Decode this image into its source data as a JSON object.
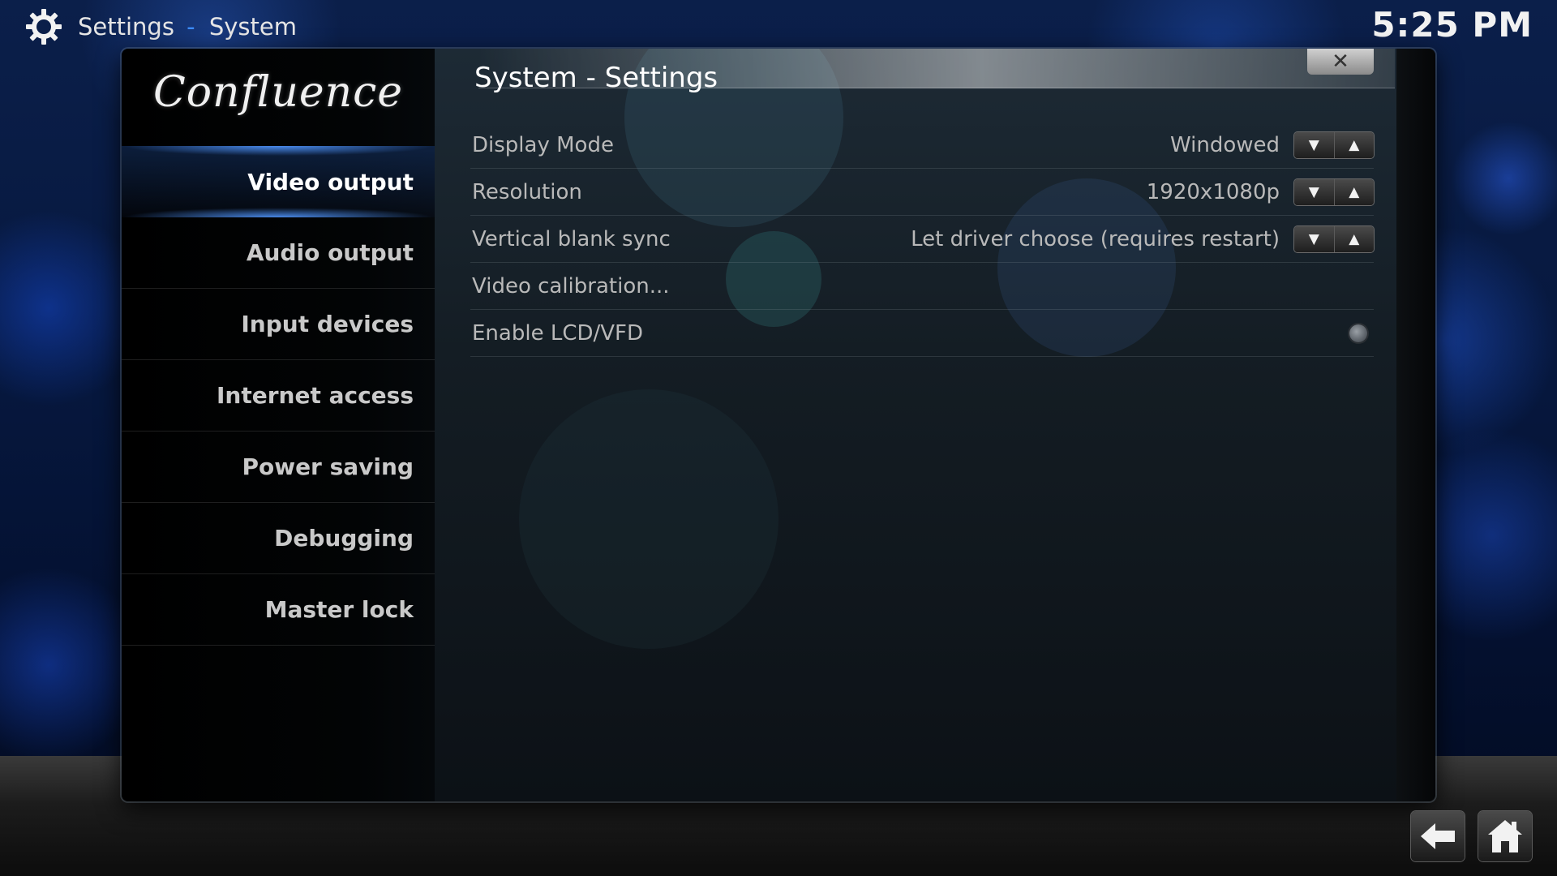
{
  "header": {
    "section": "Settings",
    "separator": "-",
    "subsection": "System",
    "icon": "gear-icon"
  },
  "clock": "5:25 PM",
  "sidebar": {
    "logo_text": "Confluence",
    "items": [
      {
        "label": "Video output",
        "active": true
      },
      {
        "label": "Audio output",
        "active": false
      },
      {
        "label": "Input devices",
        "active": false
      },
      {
        "label": "Internet access",
        "active": false
      },
      {
        "label": "Power saving",
        "active": false
      },
      {
        "label": "Debugging",
        "active": false
      },
      {
        "label": "Master lock",
        "active": false
      }
    ]
  },
  "content": {
    "title": "System - Settings",
    "close_label": "✕",
    "settings": [
      {
        "label": "Display Mode",
        "value": "Windowed",
        "control": "spinner"
      },
      {
        "label": "Resolution",
        "value": "1920x1080p",
        "control": "spinner"
      },
      {
        "label": "Vertical blank sync",
        "value": "Let driver choose (requires restart)",
        "control": "spinner"
      },
      {
        "label": "Video calibration...",
        "value": "",
        "control": "none"
      },
      {
        "label": "Enable LCD/VFD",
        "value": "",
        "control": "radio"
      }
    ],
    "spinner_down": "▼",
    "spinner_up": "▲"
  },
  "bottom_nav": {
    "back_icon": "back-arrow-icon",
    "home_icon": "home-icon"
  },
  "colors": {
    "accent": "#3d8cff",
    "text": "#e6e6e6"
  }
}
